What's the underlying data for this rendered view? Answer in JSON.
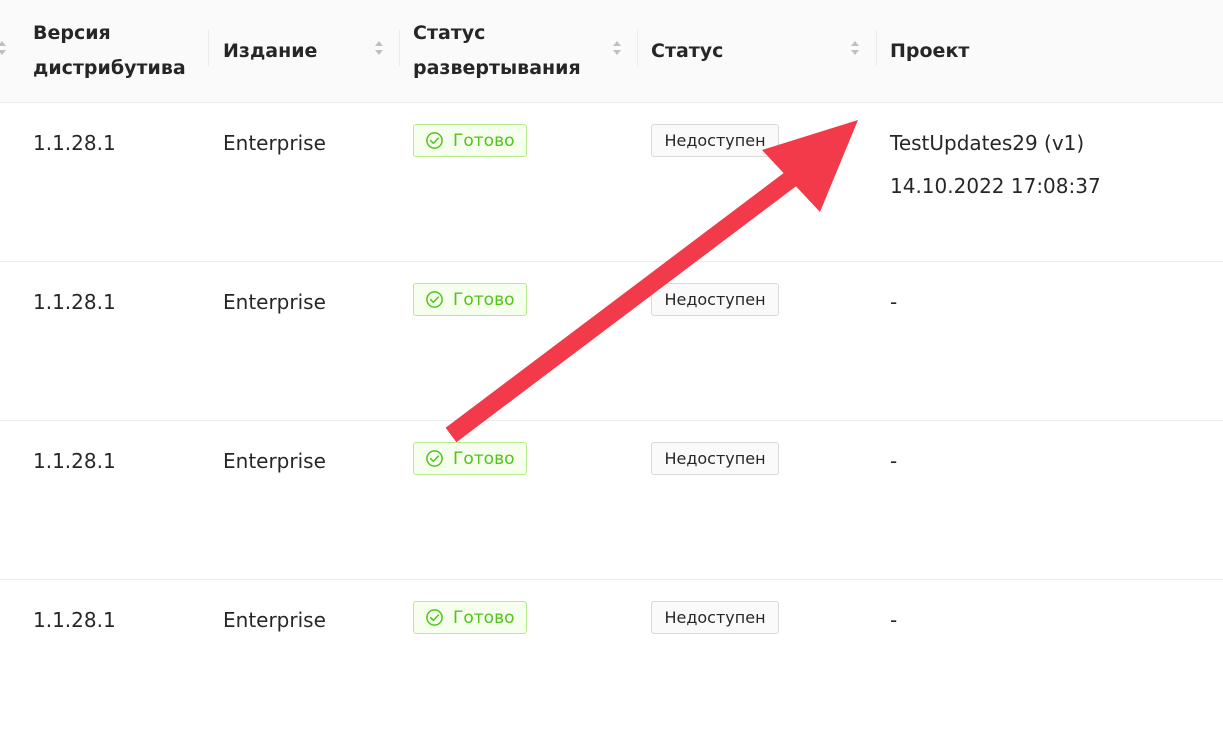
{
  "columns": [
    {
      "label_line1": "Версия",
      "label_line2": "дистрибутива"
    },
    {
      "label_line1": "Издание",
      "label_line2": ""
    },
    {
      "label_line1": "Статус",
      "label_line2": "развертывания"
    },
    {
      "label_line1": "Статус",
      "label_line2": ""
    },
    {
      "label_line1": "Проект",
      "label_line2": ""
    }
  ],
  "rows": [
    {
      "version": "1.1.28.1",
      "edition": "Enterprise",
      "deploy_status": "Готово",
      "status": "Недоступен",
      "project": "TestUpdates29 (v1)",
      "project_date": "14.10.2022 17:08:37"
    },
    {
      "version": "1.1.28.1",
      "edition": "Enterprise",
      "deploy_status": "Готово",
      "status": "Недоступен",
      "project": "-",
      "project_date": ""
    },
    {
      "version": "1.1.28.1",
      "edition": "Enterprise",
      "deploy_status": "Готово",
      "status": "Недоступен",
      "project": "-",
      "project_date": ""
    },
    {
      "version": "1.1.28.1",
      "edition": "Enterprise",
      "deploy_status": "Готово",
      "status": "Недоступен",
      "project": "-",
      "project_date": ""
    }
  ],
  "icons": {
    "ready": "check-circle-icon",
    "sorter": "sort-caret-icon",
    "annotation": "arrow-annotation"
  },
  "colors": {
    "ready_text": "#52c41a",
    "ready_border": "#b7eb8f",
    "ready_bg": "#f6ffed",
    "annotation_arrow": "#f23a4a"
  }
}
